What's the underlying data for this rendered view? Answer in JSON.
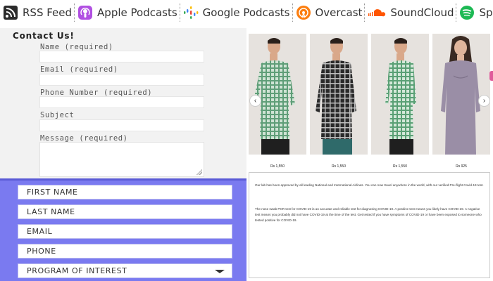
{
  "podcasts": [
    {
      "label": "RSS Feed",
      "icon": "rss-icon",
      "color": "#333333"
    },
    {
      "label": "Apple Podcasts",
      "icon": "apple-podcasts-icon",
      "color": "#b150e2"
    },
    {
      "label": "Google Podcasts",
      "icon": "google-podcasts-icon",
      "color": "#4285f4"
    },
    {
      "label": "Overcast",
      "icon": "overcast-icon",
      "color": "#fc7e0f"
    },
    {
      "label": "SoundCloud",
      "icon": "soundcloud-icon",
      "color": "#ff5500"
    },
    {
      "label": "Spotify",
      "icon": "spotify-icon",
      "color": "#1db954"
    }
  ],
  "contact": {
    "title": "Contact Us!",
    "fields": [
      "Name (required)",
      "Email (required)",
      "Phone Number (required)",
      "Subject",
      "Message (required)"
    ]
  },
  "program_form": {
    "fields": [
      "FIRST NAME",
      "LAST NAME",
      "EMAIL",
      "PHONE",
      "PROGRAM OF INTEREST"
    ],
    "accent": "#7a7af0"
  },
  "products": [
    {
      "price": "Rs 1,550",
      "shirt": "green-check"
    },
    {
      "price": "Rs 1,550",
      "shirt": "black-check"
    },
    {
      "price": "Rs 1,550",
      "shirt": "green-check"
    },
    {
      "price": "Rs 925",
      "shirt": "mauve-satin"
    }
  ],
  "covid": {
    "paragraph_1": "Our lab has been approved by all leading National and International Airlines. You can now travel anywhere in the world, with our verified Pre-flight Covid-19 test.",
    "paragraph_2": "The nose swab PCR test for COVID-19 is an accurate and reliable test for diagnosing COVID-19. A positive test means you likely have COVID-19. A negative test means you probably did not have COVID-19 at the time of the test. Get tested if you have symptoms of COVID-19 or have been exposed to someone who tested positive for COVID-19."
  }
}
